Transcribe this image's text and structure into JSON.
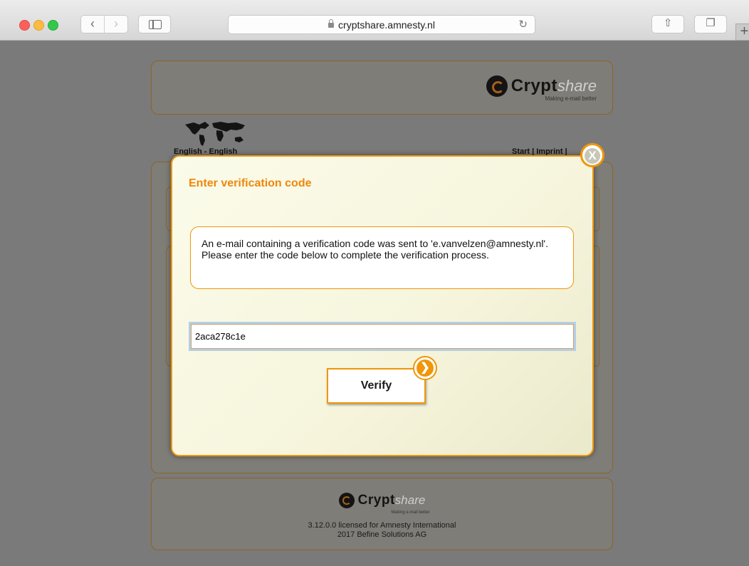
{
  "browser": {
    "url": "cryptshare.amnesty.nl",
    "back_glyph": "‹",
    "forward_glyph": "›",
    "reload_glyph": "↻",
    "share_glyph": "⇧",
    "tabs_glyph": "❐",
    "new_tab_glyph": "+"
  },
  "header": {
    "logo_crypt": "Crypt",
    "logo_share": "share",
    "logo_tagline": "Making e-mail better"
  },
  "nav": {
    "language": "English - English",
    "links": "Start | Imprint | "
  },
  "modal": {
    "close_label": "X",
    "title": "Enter verification code",
    "message": "An e-mail containing a verification code was sent to 'e.vanvelzen@amnesty.nl'. Please enter the code below to complete the verification process.",
    "code_value": "2aca278c1e",
    "verify_label": "Verify",
    "verify_arrow": "❯"
  },
  "footer": {
    "logo_crypt": "Crypt",
    "logo_share": "share",
    "logo_tagline": "Making e-mail better",
    "license_line": "3.12.0.0 licensed for Amnesty International",
    "copyright_line": "2017 Befine Solutions AG"
  },
  "colors": {
    "accent": "#f0960a",
    "title_orange": "#f0870a",
    "page_overlay": "#7a7a7a"
  }
}
